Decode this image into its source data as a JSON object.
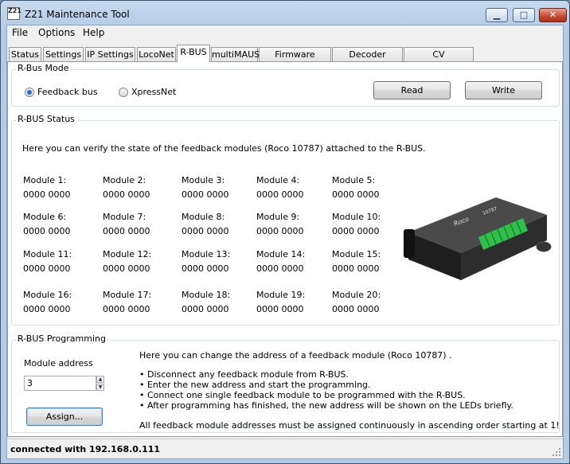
{
  "window": {
    "app_icon": "Z21",
    "title": "Z21 Maintenance Tool",
    "controls": [
      "minimize-icon",
      "maximize-icon",
      "close-icon"
    ]
  },
  "menu": {
    "file": "File",
    "options": "Options",
    "help": "Help"
  },
  "tabs": [
    {
      "label": "Status"
    },
    {
      "label": "Settings"
    },
    {
      "label": "IP Settings"
    },
    {
      "label": "LocoNet"
    },
    {
      "label": "R-BUS",
      "active": true
    },
    {
      "label": "multiMAUS"
    },
    {
      "label": "Firmware update"
    },
    {
      "label": "Decoder update"
    },
    {
      "label": "CV Programming"
    }
  ],
  "rbus_mode": {
    "title": "R-Bus Mode",
    "options": [
      {
        "label": "Feedback bus",
        "selected": true
      },
      {
        "label": "XpressNet",
        "selected": false
      }
    ],
    "read_button": "Read",
    "write_button": "Write"
  },
  "rbus_status": {
    "title": "R-BUS Status",
    "description": "Here you can verify the state of the feedback modules (Roco 10787) attached to the R-BUS.",
    "modules": [
      {
        "label": "Module 1:",
        "value": "0000 0000"
      },
      {
        "label": "Module 2:",
        "value": "0000 0000"
      },
      {
        "label": "Module 3:",
        "value": "0000 0000"
      },
      {
        "label": "Module 4:",
        "value": "0000 0000"
      },
      {
        "label": "Module 5:",
        "value": "0000 0000"
      },
      {
        "label": "Module 6:",
        "value": "0000 0000"
      },
      {
        "label": "Module 7:",
        "value": "0000 0000"
      },
      {
        "label": "Module 8:",
        "value": "0000 0000"
      },
      {
        "label": "Module 9:",
        "value": "0000 0000"
      },
      {
        "label": "Module 10:",
        "value": "0000 0000"
      },
      {
        "label": "Module 11:",
        "value": "0000 0000"
      },
      {
        "label": "Module 12:",
        "value": "0000 0000"
      },
      {
        "label": "Module 13:",
        "value": "0000 0000"
      },
      {
        "label": "Module 14:",
        "value": "0000 0000"
      },
      {
        "label": "Module 15:",
        "value": "0000 0000"
      },
      {
        "label": "Module 16:",
        "value": "0000 0000"
      },
      {
        "label": "Module 17:",
        "value": "0000 0000"
      },
      {
        "label": "Module 18:",
        "value": "0000 0000"
      },
      {
        "label": "Module 19:",
        "value": "0000 0000"
      },
      {
        "label": "Module 20:",
        "value": "0000 0000"
      }
    ],
    "device_logo": "Roco",
    "device_model": "10787"
  },
  "programming": {
    "title": "R-BUS Programming",
    "address_label": "Module address",
    "address_value": "3",
    "assign_button": "Assign...",
    "intro": "Here you can change the address of a feedback module (Roco 10787) .",
    "steps": [
      "• Disconnect any feedback module from R-BUS.",
      "• Enter the new address and start the programming.",
      "• Connect one single feedback module to be programmed with the R-BUS.",
      "• After programming has finished, the new address will be shown on the LEDs briefly."
    ],
    "note": "All feedback module addresses must be assigned continuously in ascending order starting at 1!"
  },
  "status_bar": {
    "text": "connected with 192.168.0.111"
  }
}
